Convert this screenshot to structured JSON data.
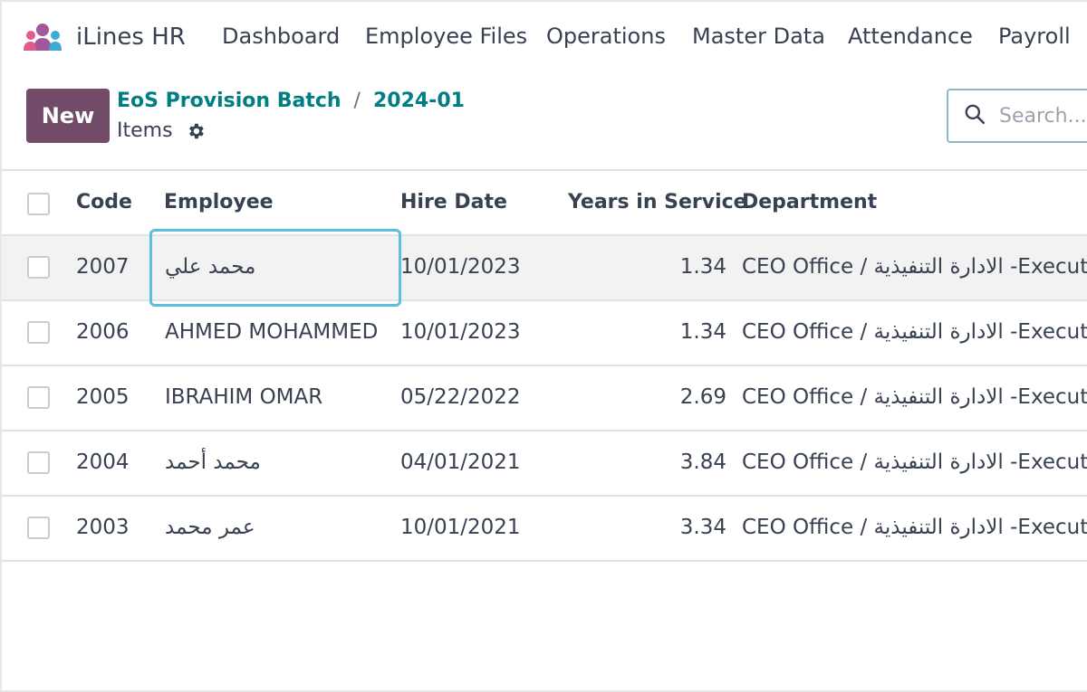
{
  "app": {
    "name": "iLines HR",
    "logo_icon": "users-group-icon"
  },
  "menu": [
    {
      "label": "Dashboard"
    },
    {
      "label": "Employee Files"
    },
    {
      "label": "Operations"
    },
    {
      "label": "Master Data"
    },
    {
      "label": "Attendance"
    },
    {
      "label": "Payroll"
    }
  ],
  "control": {
    "new_label": "New",
    "breadcrumb": [
      {
        "label": "EoS Provision Batch"
      },
      {
        "label": "2024-01"
      }
    ],
    "breadcrumb_separator": "/",
    "subtitle": "Items",
    "search_placeholder": "Search..."
  },
  "table": {
    "columns": {
      "code": "Code",
      "employee": "Employee",
      "hire_date": "Hire Date",
      "years": "Years in Service",
      "department": "Department"
    },
    "rows": [
      {
        "code": "2007",
        "employee": "محمد علي",
        "hire_date": "10/01/2023",
        "years": "1.34",
        "department": "CEO Office / الادارة التنفيذية -Execut"
      },
      {
        "code": "2006",
        "employee": "AHMED MOHAMMED",
        "hire_date": "10/01/2023",
        "years": "1.34",
        "department": "CEO Office / الادارة التنفيذية -Execut"
      },
      {
        "code": "2005",
        "employee": "IBRAHIM OMAR",
        "hire_date": "05/22/2022",
        "years": "2.69",
        "department": "CEO Office / الادارة التنفيذية -Execut"
      },
      {
        "code": "2004",
        "employee": "محمد أحمد",
        "hire_date": "04/01/2021",
        "years": "3.84",
        "department": "CEO Office / الادارة التنفيذية -Execut"
      },
      {
        "code": "2003",
        "employee": "عمر محمد",
        "hire_date": "10/01/2021",
        "years": "3.34",
        "department": "CEO Office / الادارة التنفيذية -Execut"
      }
    ]
  },
  "colors": {
    "brand_primary": "#714b67",
    "link": "#017e84",
    "focus": "#5bc0de"
  }
}
